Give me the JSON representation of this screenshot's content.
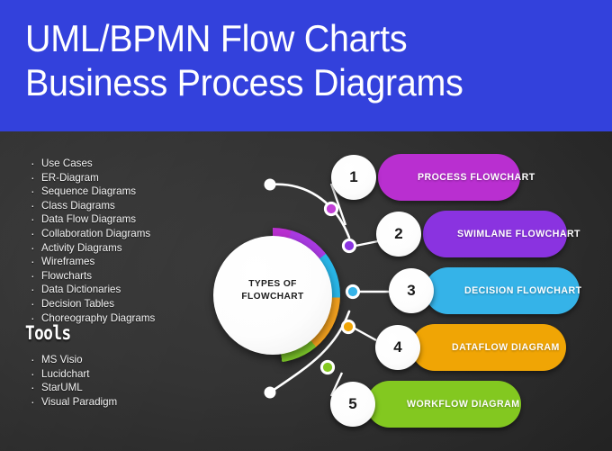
{
  "header": {
    "title_line_1": "UML/BPMN Flow Charts",
    "title_line_2": "Business Process Diagrams",
    "background_color": "#3341dc",
    "text_color": "#ffffff"
  },
  "sidebar": {
    "types_list": [
      "Use Cases",
      "ER-Diagram",
      "Sequence Diagrams",
      "Class Diagrams",
      "Data Flow Diagrams",
      "Collaboration Diagrams",
      "Activity Diagrams",
      "Wireframes",
      "Flowcharts",
      "Data Dictionaries",
      "Decision Tables",
      "Choreography Diagrams"
    ],
    "tools_heading": "Tools",
    "tools_list": [
      "MS Visio",
      "Lucidchart",
      "StarUML",
      "Visual Paradigm"
    ]
  },
  "diagram": {
    "center_label_line_1": "TYPES OF",
    "center_label_line_2": "FLOWCHART",
    "background_color": "#2f2f2f",
    "items": [
      {
        "number": "1",
        "label": "PROCESS FLOWCHART",
        "color": "#b92fd0"
      },
      {
        "number": "2",
        "label": "SWIMLANE FLOWCHART",
        "color": "#8a33e0"
      },
      {
        "number": "3",
        "label": "DECISION FLOWCHART",
        "color": "#35b3e8"
      },
      {
        "number": "4",
        "label": "DATAFLOW DIAGRAM",
        "color": "#f0a505"
      },
      {
        "number": "5",
        "label": "WORKFLOW DIAGRAM",
        "color": "#83c820"
      }
    ]
  }
}
